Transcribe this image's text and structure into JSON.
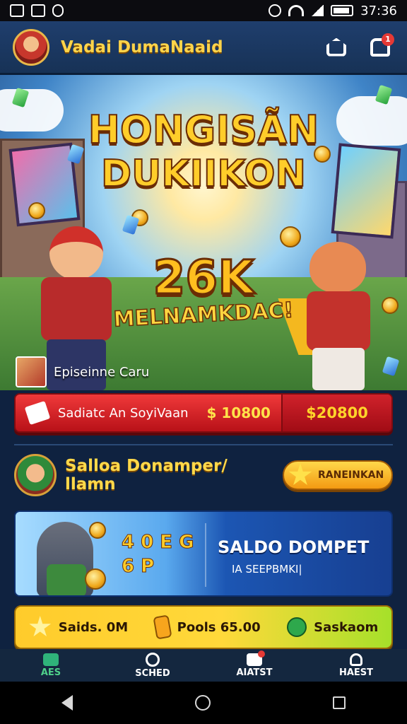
{
  "status_bar": {
    "time": "37:36"
  },
  "header": {
    "app_name": "Vadai DumaNaaid"
  },
  "hero": {
    "title_line1": "HONGISÃN",
    "title_line2": "DUKIIKON",
    "amount": "26K",
    "subtitle": "MELNAMKDAC!",
    "player_label": "Episeinne Caru"
  },
  "reward_bar": {
    "text": "Sadiatc An SoyiVaan",
    "amount": "$ 10800",
    "button": "$20800"
  },
  "profile": {
    "name": "Salloa Donamper/ llamn",
    "ranking_button": "RANEINKAN"
  },
  "wallet_card": {
    "art_text_1": "4 0 E G",
    "art_text_2": "6 P",
    "title": "SALDO DOMPET",
    "subtitle": "IA SEEPBMKI|"
  },
  "stats": [
    {
      "label": "Saids. 0M",
      "icon": "star-icon"
    },
    {
      "label": "Pools 65.00",
      "icon": "coin-icon"
    },
    {
      "label": "Saskaom",
      "icon": "gem-icon"
    }
  ],
  "bottom_nav": [
    {
      "label": "AES",
      "icon": "home-icon",
      "active": true
    },
    {
      "label": "SCHED",
      "icon": "gear-icon",
      "active": false
    },
    {
      "label": "AIATST",
      "icon": "document-icon",
      "active": false
    },
    {
      "label": "HAEST",
      "icon": "person-icon",
      "active": false
    }
  ],
  "notification_badge": "1",
  "colors": {
    "accent_gold": "#ffcd2a",
    "reward_red": "#e3252c",
    "wallet_blue": "#1c56b3",
    "nav_active_green": "#4fd08a"
  }
}
